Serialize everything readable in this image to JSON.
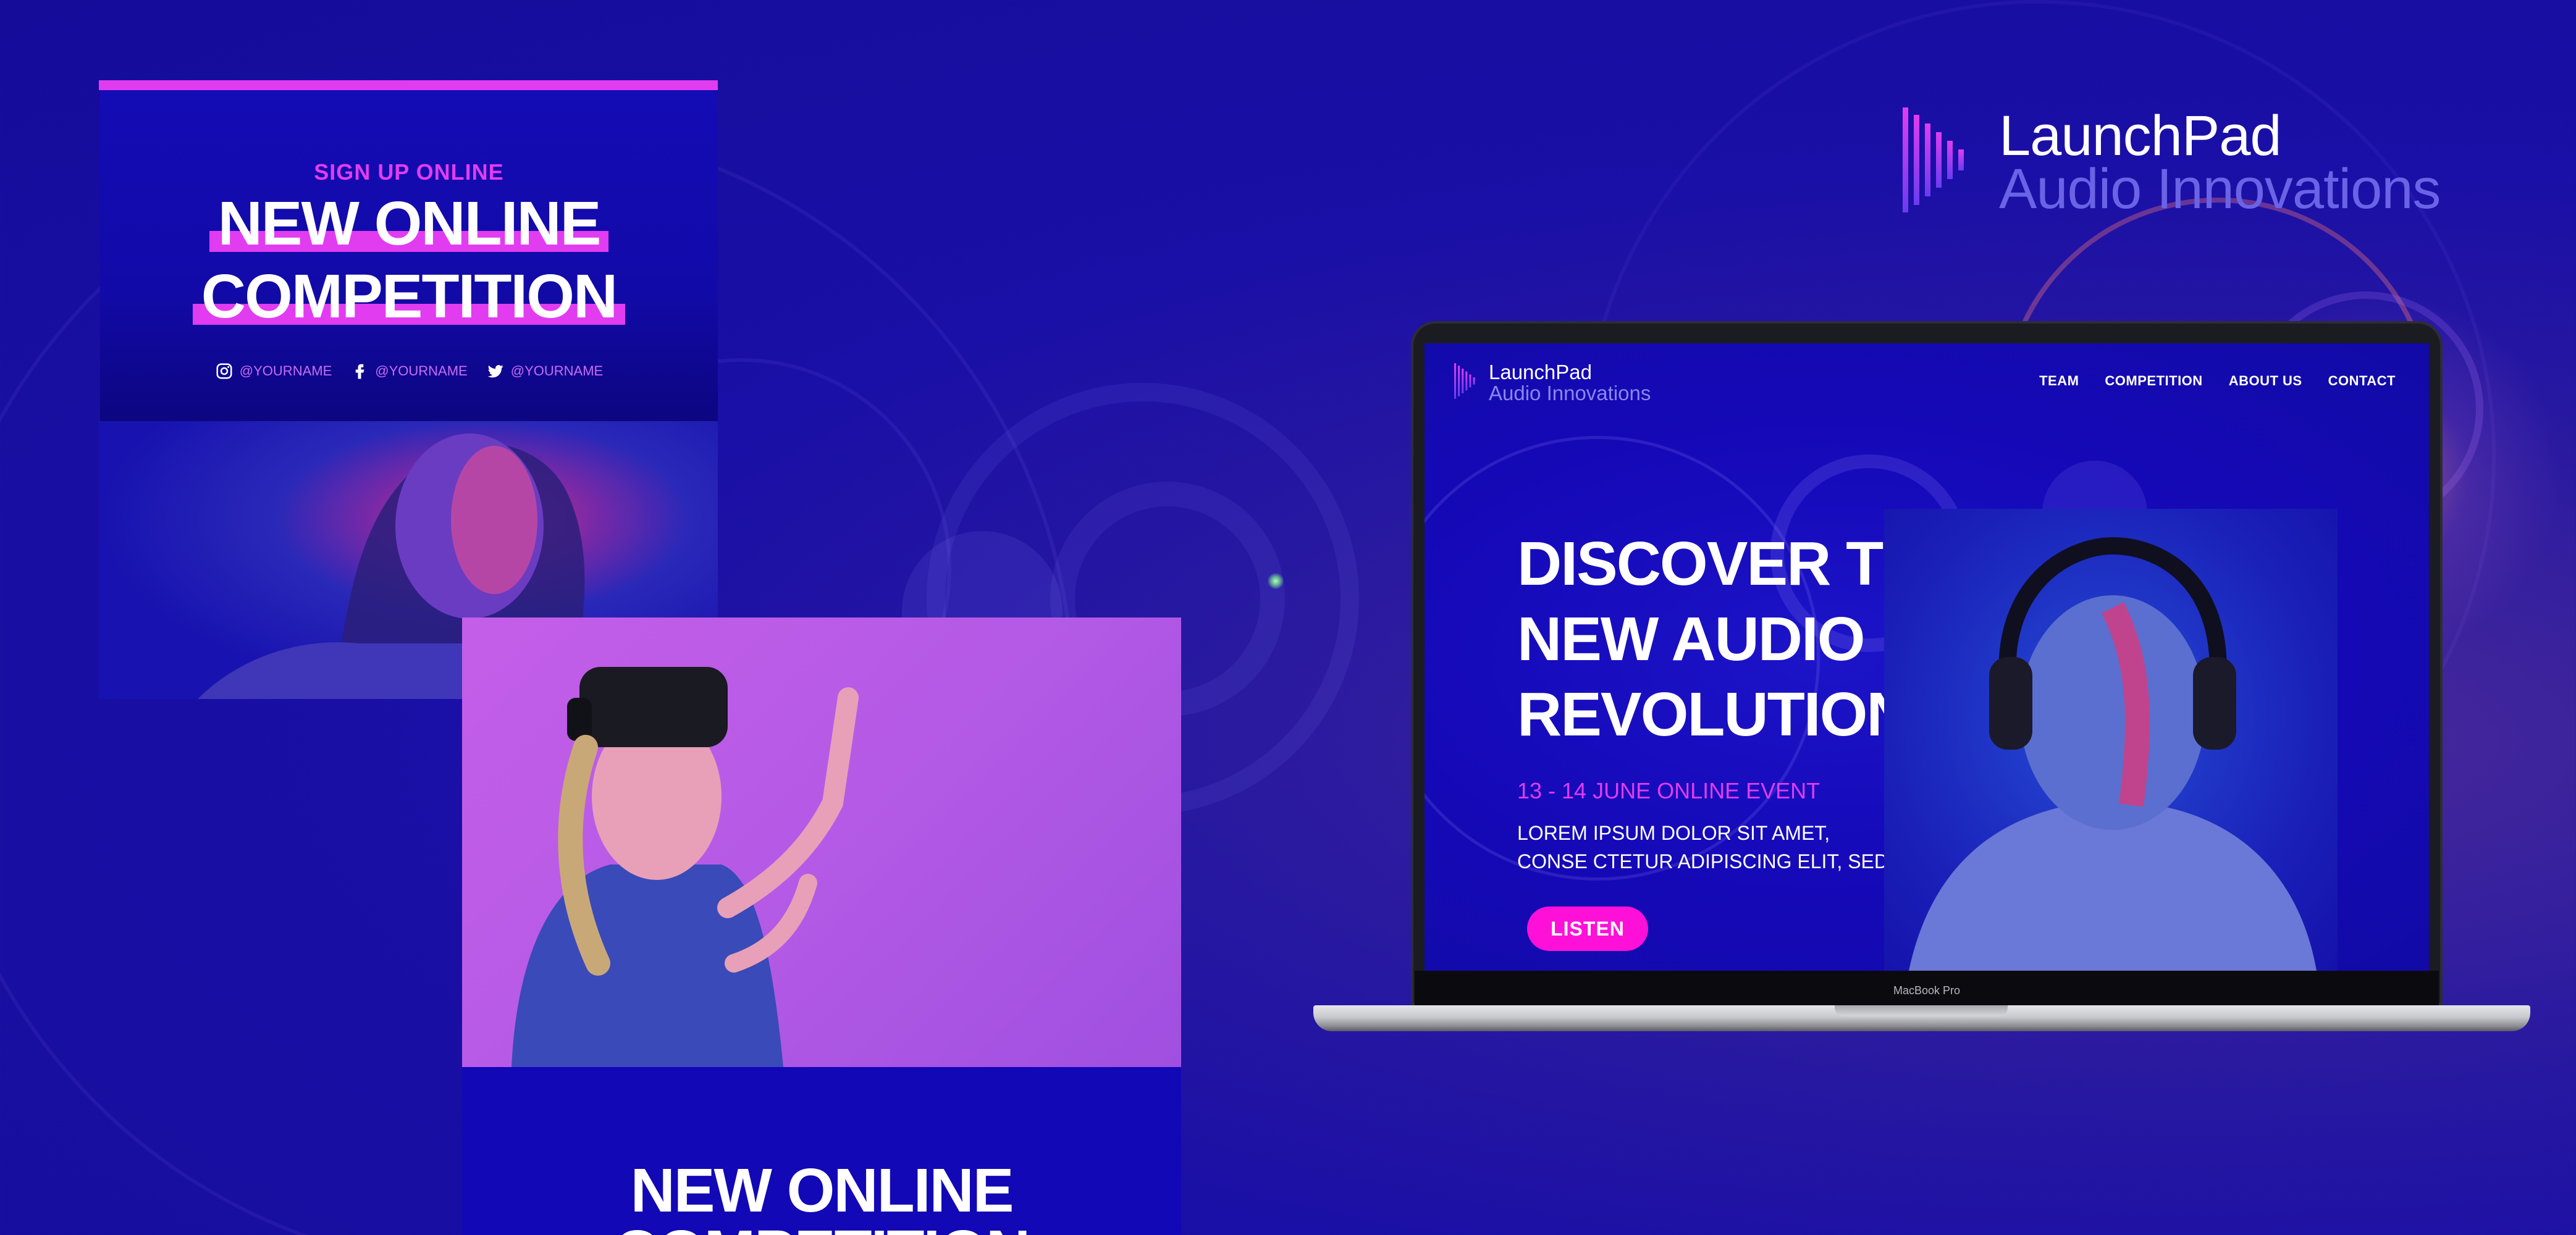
{
  "colors": {
    "background": "#1a0fa6",
    "accent_pink": "#e13cf0",
    "button": "#ff10d8",
    "logo_sub": "#6a63e6"
  },
  "brand": {
    "name_line1": "LaunchPad",
    "name_line2": "Audio Innovations",
    "icon": "audio-bars-play-icon"
  },
  "post_top": {
    "kicker": "SIGN UP ONLINE",
    "headline_line1": "NEW ONLINE",
    "headline_line2": "COMPETITION",
    "socials": [
      {
        "icon": "instagram-icon",
        "handle": "@YOURNAME"
      },
      {
        "icon": "facebook-icon",
        "handle": "@YOURNAME"
      },
      {
        "icon": "twitter-icon",
        "handle": "@YOURNAME"
      }
    ],
    "photo": "woman-portrait-photo"
  },
  "post_bottom": {
    "photo": "woman-vr-headset-photo",
    "headline": "NEW ONLINE COMPETITION"
  },
  "laptop": {
    "model_label": "MacBook Pro",
    "site": {
      "nav": [
        "TEAM",
        "COMPETITION",
        "ABOUT US",
        "CONTACT"
      ],
      "hero_title": [
        "DISCOVER THE",
        "NEW AUDIO",
        "REVOLUTION"
      ],
      "event_date": "13 - 14 JUNE ONLINE EVENT",
      "body_line1": "LOREM IPSUM DOLOR SIT AMET,",
      "body_line2": "CONSE CTETUR ADIPISCING ELIT, SED",
      "cta": "LISTEN",
      "photo": "man-headphones-photo"
    }
  }
}
